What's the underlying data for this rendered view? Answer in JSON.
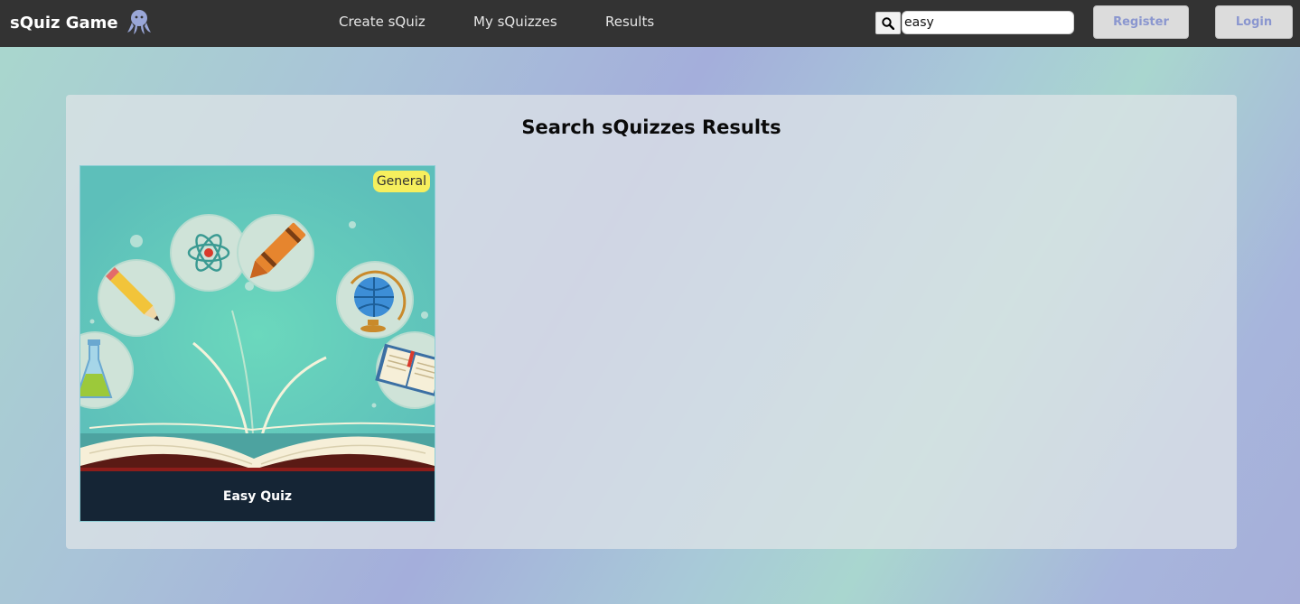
{
  "navbar": {
    "brand": "sQuiz Game",
    "links": [
      "Create sQuiz",
      "My sQuizzes",
      "Results"
    ],
    "search": {
      "value": "easy",
      "icon": "search-icon"
    },
    "register_label": "Register",
    "login_label": "Login"
  },
  "main": {
    "title": "Search sQuizzes Results",
    "cards": [
      {
        "title": "Easy Quiz",
        "category": "General"
      }
    ]
  },
  "colors": {
    "navbar": "#333333",
    "card_footer": "#152535",
    "badge": "#f6ef5d",
    "auth_button_text": "#8a96cf"
  }
}
